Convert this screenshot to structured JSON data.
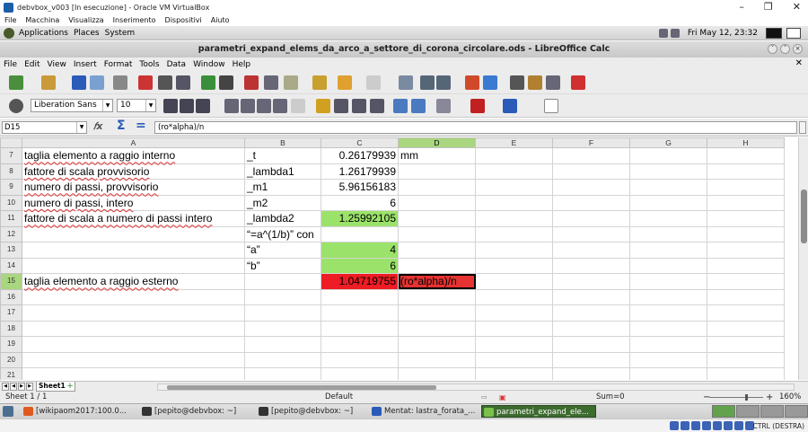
{
  "host": {
    "title": "debvbox_v003 [In esecuzione] - Oracle VM VirtualBox",
    "menu": [
      "File",
      "Macchina",
      "Visualizza",
      "Inserimento",
      "Dispositivi",
      "Aiuto"
    ],
    "hostkey": "CTRL (DESTRA)"
  },
  "guest_panel": {
    "menus": [
      "Applications",
      "Places",
      "System"
    ],
    "clock": "Fri May 12, 23:32"
  },
  "calc": {
    "title": "parametri_expand_elems_da_arco_a_settore_di_corona_circolare.ods - LibreOffice Calc",
    "menu": [
      "File",
      "Edit",
      "View",
      "Insert",
      "Format",
      "Tools",
      "Data",
      "Window",
      "Help"
    ],
    "font_name": "Liberation Sans",
    "font_size": "10",
    "name_box": "D15",
    "formula": "(ro*alpha)/n",
    "columns": [
      "A",
      "B",
      "C",
      "D",
      "E",
      "F",
      "G",
      "H"
    ],
    "rows": [
      {
        "n": "7",
        "a": "taglia elemento a raggio interno",
        "b": "_t",
        "c": "0.26179939",
        "d": "mm"
      },
      {
        "n": "8",
        "a": "fattore di scala provvisorio",
        "b": "_lambda1",
        "c": "1.26179939",
        "d": ""
      },
      {
        "n": "9",
        "a": "numero di passi, provvisorio",
        "b": "_m1",
        "c": "5.96156183",
        "d": ""
      },
      {
        "n": "10",
        "a": "numero di passi, intero",
        "b": "_m2",
        "c": "6",
        "d": ""
      },
      {
        "n": "11",
        "a": "fattore di scala a numero di passi intero",
        "b": "_lambda2",
        "c": "1.25992105",
        "d": ""
      },
      {
        "n": "12",
        "a": "",
        "b": "“=a^(1/b)” con",
        "c": "",
        "d": ""
      },
      {
        "n": "13",
        "a": "",
        "b": "“a”",
        "c": "4",
        "d": ""
      },
      {
        "n": "14",
        "a": "",
        "b": "“b”",
        "c": "6",
        "d": ""
      },
      {
        "n": "15",
        "a": "taglia elemento a raggio esterno",
        "b": "",
        "c": "1.04719755",
        "d": "(ro*alpha)/n"
      },
      {
        "n": "16",
        "a": "",
        "b": "",
        "c": "",
        "d": ""
      },
      {
        "n": "17",
        "a": "",
        "b": "",
        "c": "",
        "d": ""
      },
      {
        "n": "18",
        "a": "",
        "b": "",
        "c": "",
        "d": ""
      },
      {
        "n": "19",
        "a": "",
        "b": "",
        "c": "",
        "d": ""
      },
      {
        "n": "20",
        "a": "",
        "b": "",
        "c": "",
        "d": ""
      },
      {
        "n": "21",
        "a": "",
        "b": "",
        "c": "",
        "d": ""
      }
    ],
    "sheet_tab": "Sheet1",
    "status": {
      "sheet": "Sheet 1 / 1",
      "style": "Default",
      "sum": "Sum=0",
      "zoom": "160%"
    }
  },
  "taskbar": [
    "[wikipaom2017:100.0...",
    "[pepito@debvbox: ~]",
    "[pepito@debvbox: ~]",
    "Mentat: lastra_forata_...",
    "parametri_expand_ele..."
  ]
}
